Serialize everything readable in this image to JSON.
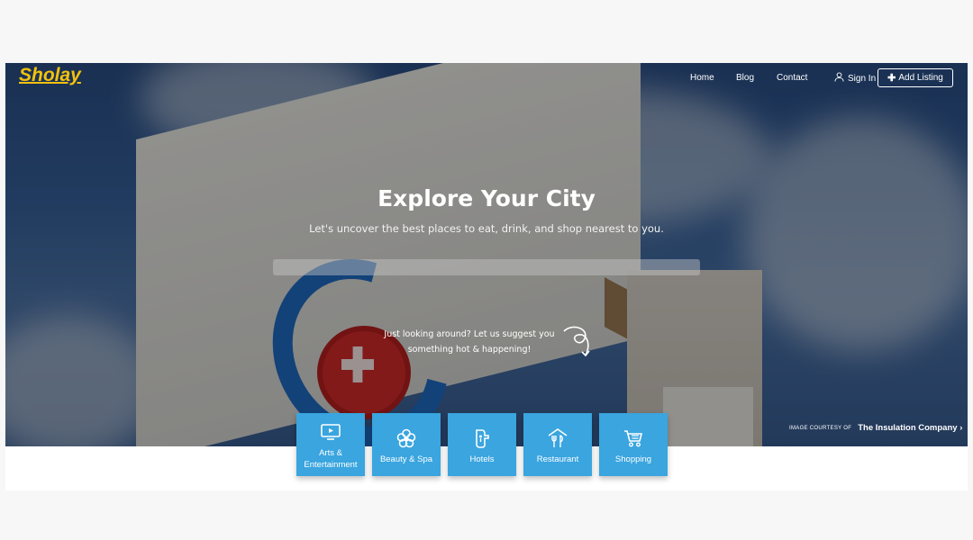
{
  "brand": {
    "name": "Sholay",
    "color": "#f4c20d"
  },
  "nav": {
    "links": [
      "Home",
      "Blog",
      "Contact"
    ],
    "signin_label": "Sign In",
    "add_listing_label": "Add Listing"
  },
  "hero": {
    "title": "Explore Your City",
    "subtitle": "Let's uncover the best places to eat, drink, and shop nearest to you.",
    "search_placeholder": "",
    "suggest_line1": "Just looking around? Let us suggest you",
    "suggest_line2": "something hot & happening!"
  },
  "credit": {
    "prefix": "IMAGE COURTESY OF",
    "company": "The Insulation Company",
    "chevron": "›"
  },
  "categories": [
    {
      "label": "Arts & Entertainment",
      "icon": "tv-icon"
    },
    {
      "label": "Beauty & Spa",
      "icon": "flower-icon"
    },
    {
      "label": "Hotels",
      "icon": "door-handle-icon"
    },
    {
      "label": "Restaurant",
      "icon": "restaurant-icon"
    },
    {
      "label": "Shopping",
      "icon": "cart-icon"
    }
  ],
  "colors": {
    "accent": "#3aa5df",
    "page_bg": "#f7f7f8"
  }
}
